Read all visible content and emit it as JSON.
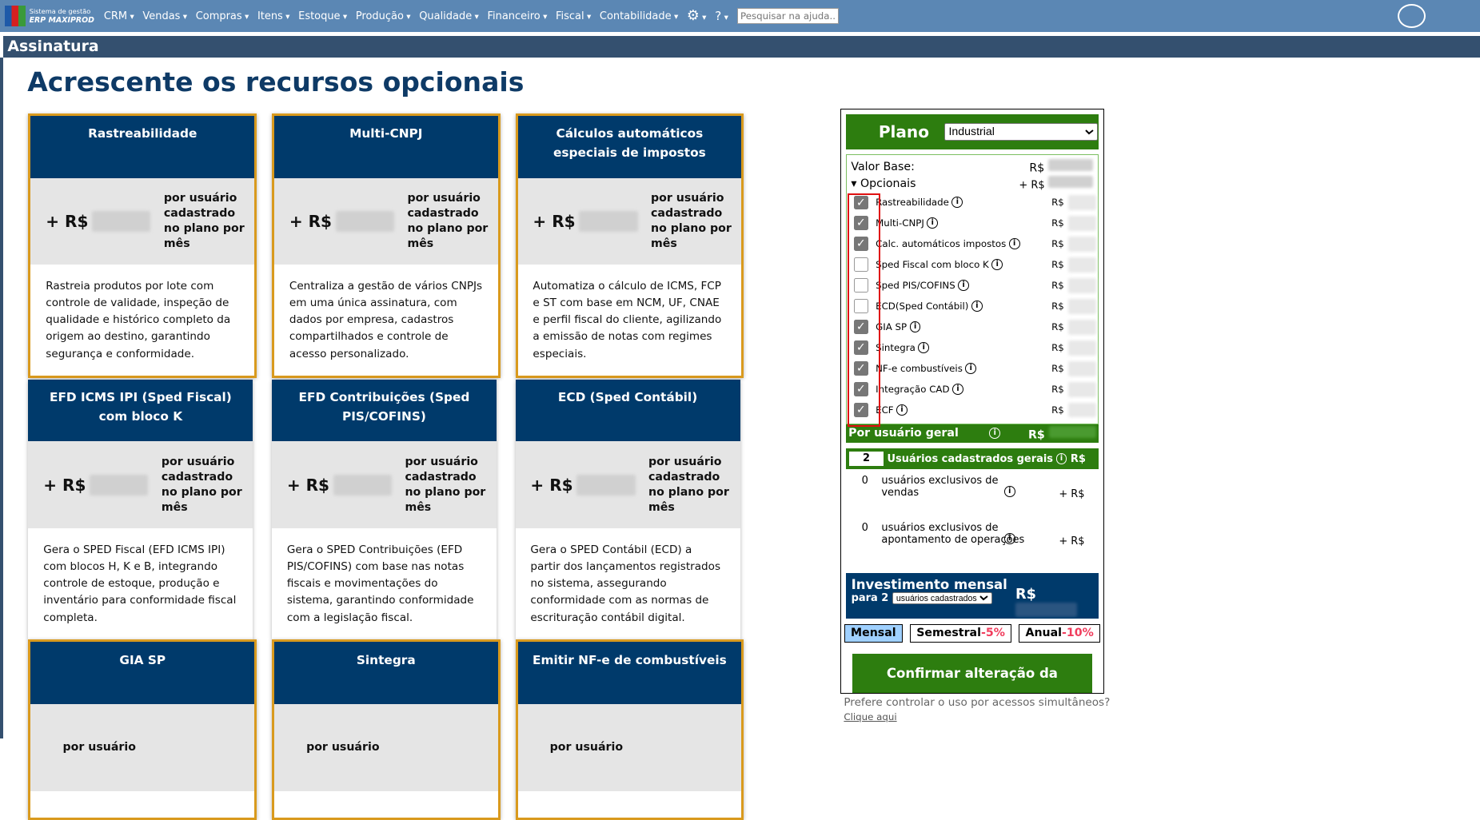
{
  "nav": {
    "logo_line1": "Sistema de gestão",
    "logo_line2": "ERP MAXIPROD",
    "menus": [
      "CRM",
      "Vendas",
      "Compras",
      "Itens",
      "Estoque",
      "Produção",
      "Qualidade",
      "Financeiro",
      "Fiscal",
      "Contabilidade"
    ],
    "search_placeholder": "Pesquisar na ajuda..."
  },
  "page": {
    "title": "Assinatura",
    "heading": "Acrescente os recursos opcionais"
  },
  "cards": [
    {
      "title": "Rastreabilidade",
      "price_prefix": "+ R$",
      "per": "por usuário cadastrado no plano por mês",
      "desc": "Rastreia produtos por lote com controle de validade, inspeção de qualidade e histórico completo da origem ao destino, garantindo segurança e conformidade.",
      "selected": true
    },
    {
      "title": "Multi-CNPJ",
      "price_prefix": "+ R$",
      "per": "por usuário cadastrado no plano por mês",
      "desc": "Centraliza a gestão de vários CNPJs em uma única assinatura, com dados por empresa, cadastros compartilhados e controle de acesso personalizado.",
      "selected": true
    },
    {
      "title": "Cálculos automáticos especiais de impostos",
      "price_prefix": "+ R$",
      "per": "por usuário cadastrado no plano por mês",
      "desc": "Automatiza o cálculo de ICMS, FCP e ST com base em NCM, UF, CNAE e perfil fiscal do cliente, agilizando a emissão de notas com regimes especiais.",
      "selected": true
    },
    {
      "title": "EFD ICMS IPI (Sped Fiscal) com bloco K",
      "price_prefix": "+ R$",
      "per": "por usuário cadastrado no plano por mês",
      "desc": "Gera o SPED Fiscal (EFD ICMS IPI) com blocos H, K e B, integrando controle de estoque, produção e inventário para conformidade fiscal completa.",
      "selected": false
    },
    {
      "title": "EFD Contribuições (Sped PIS/COFINS)",
      "price_prefix": "+ R$",
      "per": "por usuário cadastrado no plano por mês",
      "desc": "Gera o SPED Contribuições (EFD PIS/COFINS) com base nas notas fiscais e movimentações do sistema, garantindo conformidade com a legislação fiscal.",
      "selected": false
    },
    {
      "title": "ECD (Sped Contábil)",
      "price_prefix": "+ R$",
      "per": "por usuário cadastrado no plano por mês",
      "desc": "Gera o SPED Contábil (ECD) a partir dos lançamentos registrados no sistema, assegurando conformidade com as normas de escrituração contábil digital.",
      "selected": false
    },
    {
      "title": "GIA SP",
      "price_prefix": "",
      "per": "por usuário",
      "desc": "",
      "selected": true
    },
    {
      "title": "Sintegra",
      "price_prefix": "",
      "per": "por usuário",
      "desc": "",
      "selected": true
    },
    {
      "title": "Emitir NF-e de combustíveis",
      "price_prefix": "",
      "per": "por usuário",
      "desc": "",
      "selected": true
    }
  ],
  "plan": {
    "label": "Plano",
    "selected": "Industrial",
    "valor_base": "Valor Base:",
    "rs": "R$",
    "opcionais": "Opcionais",
    "plus_rs": "+ R$",
    "options": [
      {
        "label": "Rastreabilidade",
        "checked": true
      },
      {
        "label": "Multi-CNPJ",
        "checked": true
      },
      {
        "label": "Calc. automáticos impostos",
        "checked": true
      },
      {
        "label": "Sped Fiscal com bloco K",
        "checked": false
      },
      {
        "label": "Sped PIS/COFINS",
        "checked": false
      },
      {
        "label": "ECD(Sped Contábil)",
        "checked": false
      },
      {
        "label": "GIA SP",
        "checked": true
      },
      {
        "label": "Sintegra",
        "checked": true
      },
      {
        "label": "NF-e combustíveis",
        "checked": true
      },
      {
        "label": "Integração CAD",
        "checked": true
      },
      {
        "label": "ECF",
        "checked": true
      }
    ],
    "por_usuario": "Por usuário geral",
    "users_count": "2",
    "users_label": "Usuários cadastrados gerais",
    "vendas_count": "0",
    "vendas_label": "usuários exclusivos de vendas",
    "apont_count": "0",
    "apont_label": "usuários exclusivos de apontamento de operações",
    "invest_title": "Investimento mensal",
    "invest_para": "para 2",
    "invest_select": "usuários cadastrados",
    "periods": {
      "mensal": "Mensal",
      "semestral": "Semestral",
      "semestral_disc": "-5%",
      "anual": "Anual",
      "anual_disc": "-10%"
    },
    "confirm": "Confirmar alteração da assinatura"
  },
  "footer": {
    "question": "Prefere controlar o uso por acessos simultâneos?",
    "link": "Clique aqui"
  },
  "colors": {
    "navy": "#003a6b",
    "green": "#2d7d0f",
    "gold": "#d99a1e",
    "topbar": "#5b87b4"
  }
}
